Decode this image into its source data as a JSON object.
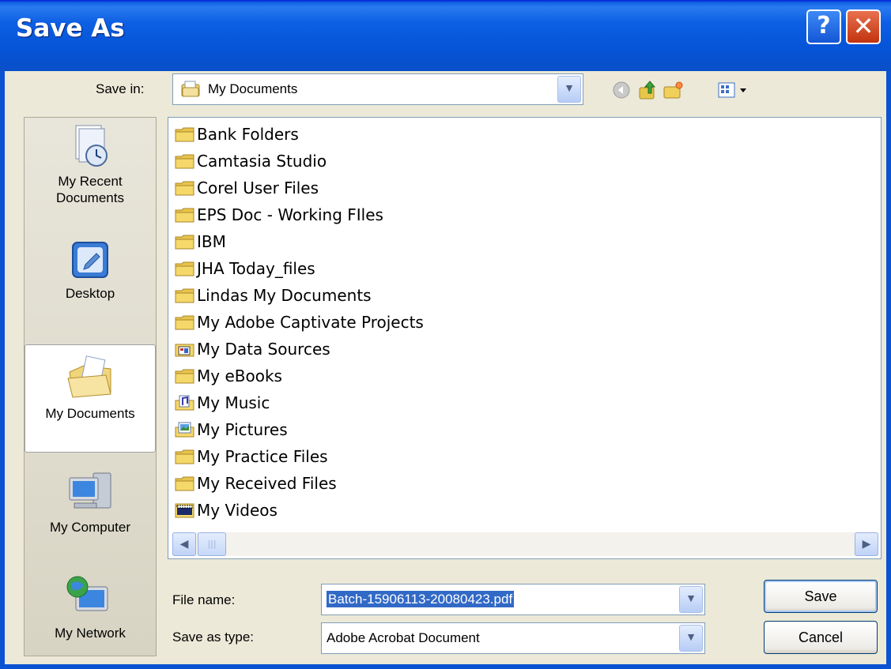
{
  "window": {
    "title": "Save As",
    "help_label": "?",
    "close_label": "✕"
  },
  "save_in": {
    "label": "Save in:",
    "value": "My Documents"
  },
  "places": [
    {
      "id": "recent",
      "label_line1": "My Recent",
      "label_line2": "Documents"
    },
    {
      "id": "desktop",
      "label_line1": "Desktop",
      "label_line2": ""
    },
    {
      "id": "mydocuments",
      "label_line1": "My Documents",
      "label_line2": ""
    },
    {
      "id": "mycomputer",
      "label_line1": "My Computer",
      "label_line2": ""
    },
    {
      "id": "mynetwork",
      "label_line1": "My Network",
      "label_line2": ""
    }
  ],
  "files": [
    {
      "name": "Bank Folders",
      "icon": "folder"
    },
    {
      "name": "Camtasia Studio",
      "icon": "folder"
    },
    {
      "name": "Corel User Files",
      "icon": "folder"
    },
    {
      "name": "EPS Doc - Working FIles",
      "icon": "folder"
    },
    {
      "name": "IBM",
      "icon": "folder"
    },
    {
      "name": "JHA Today_files",
      "icon": "folder"
    },
    {
      "name": "Lindas My Documents",
      "icon": "folder"
    },
    {
      "name": "My Adobe Captivate Projects",
      "icon": "folder"
    },
    {
      "name": "My Data Sources",
      "icon": "data-sources-folder"
    },
    {
      "name": "My eBooks",
      "icon": "folder"
    },
    {
      "name": "My Music",
      "icon": "music-folder"
    },
    {
      "name": "My Pictures",
      "icon": "pictures-folder"
    },
    {
      "name": "My Practice Files",
      "icon": "folder"
    },
    {
      "name": "My Received Files",
      "icon": "folder"
    },
    {
      "name": "My Videos",
      "icon": "videos-folder"
    }
  ],
  "file_name": {
    "label": "File name:",
    "value": "Batch-15906113-20080423.pdf"
  },
  "save_as_type": {
    "label": "Save as type:",
    "value": "Adobe Acrobat Document"
  },
  "buttons": {
    "save": "Save",
    "cancel": "Cancel"
  },
  "colors": {
    "titlebar": "#0553d6",
    "selection": "#3169c6",
    "dialog_bg": "#ece9d8"
  }
}
